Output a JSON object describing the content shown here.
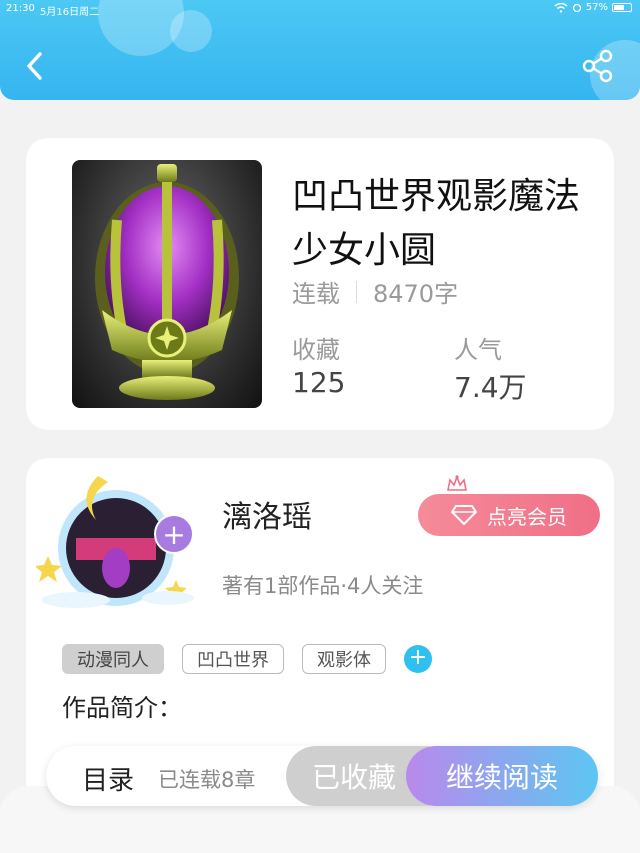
{
  "statusbar": {
    "time": "21:30",
    "date": "5月16日周二",
    "battery": "57%"
  },
  "header": {
    "back_icon": "chevron-left-icon",
    "share_icon": "share-icon"
  },
  "book": {
    "title": "凹凸世界观影魔法少女小圆",
    "status": "连载",
    "word_count": "8470字",
    "favorites_label": "收藏",
    "favorites_value": "125",
    "popularity_label": "人气",
    "popularity_value": "7.4万"
  },
  "author": {
    "name": "漓洛瑶",
    "meta": "著有1部作品·4人关注",
    "vip_button": "点亮会员",
    "follow_icon": "plus-icon"
  },
  "tags": [
    "动漫同人",
    "凹凸世界",
    "观影体"
  ],
  "intro_label": "作品简介：",
  "bottom": {
    "toc": "目录",
    "chapters": "已连载8章",
    "collected": "已收藏",
    "continue": "继续阅读"
  },
  "colors": {
    "accent": "#35b5f0",
    "vip": "#f06f86",
    "read_gradient_start": "#b989ec",
    "read_gradient_end": "#5cc6f2"
  }
}
